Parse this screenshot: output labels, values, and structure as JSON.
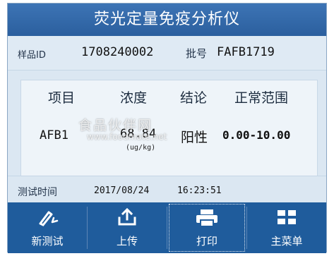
{
  "title": "荧光定量免疫分析仪",
  "sample": {
    "id_label": "样品ID",
    "id_value": "1708240002",
    "batch_label": "批号",
    "batch_value": "FAFB1719"
  },
  "table": {
    "headers": [
      "项目",
      "浓度",
      "结论",
      "正常范围"
    ],
    "row": {
      "item": "AFB1",
      "concentration": "68.84",
      "unit": "(ug/kg)",
      "result": "阳性",
      "range": "0.00-10.00"
    }
  },
  "test_time": {
    "label": "测试时间",
    "date": "2017/08/24",
    "time": "16:23:51"
  },
  "buttons": [
    {
      "label": "新测试",
      "icon": "pen-icon"
    },
    {
      "label": "上传",
      "icon": "upload-icon"
    },
    {
      "label": "打印",
      "icon": "printer-icon"
    },
    {
      "label": "主菜单",
      "icon": "grid-menu-icon"
    }
  ],
  "watermark": {
    "line1": "食品伙伴网",
    "line2": "www.foodmate.net"
  },
  "colors": {
    "header": "#2b5f9e",
    "toolbar": "#1f5c9c",
    "panel": "#dbe7f2"
  }
}
